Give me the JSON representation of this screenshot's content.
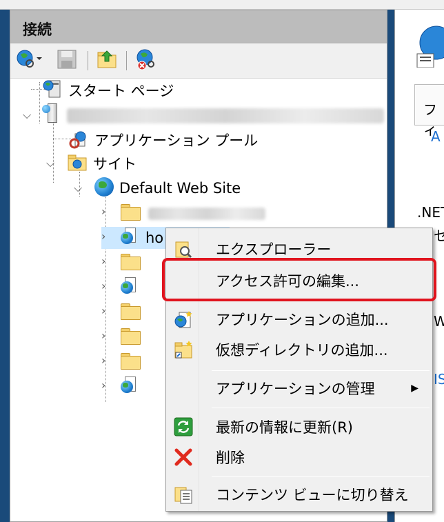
{
  "panel": {
    "title": "接続"
  },
  "toolbar": {
    "icons": [
      "connect-globe-icon",
      "save-icon",
      "up-folder-icon",
      "disconnect-icon"
    ]
  },
  "tree": {
    "start_page": "スタート ページ",
    "server": "",
    "app_pools": "アプリケーション プール",
    "sites": "サイト",
    "default_site": "Default Web Site",
    "selected_app": "ho"
  },
  "context_menu": {
    "items": [
      {
        "label": "エクスプローラー",
        "icon": "explorer-icon"
      },
      {
        "label": "アクセス許可の編集...",
        "icon": ""
      },
      {
        "label": "アプリケーションの追加...",
        "icon": "add-application-icon"
      },
      {
        "label": "仮想ディレクトリの追加...",
        "icon": "add-virtual-directory-icon"
      },
      {
        "label": "アプリケーションの管理",
        "icon": ""
      },
      {
        "label": "最新の情報に更新(R)",
        "icon": "refresh-icon"
      },
      {
        "label": "削除",
        "icon": "delete-icon"
      },
      {
        "label": "コンテンツ ビューに切り替え",
        "icon": "content-view-icon"
      }
    ]
  },
  "right_panel": {
    "tab": "フィ",
    "a1": "A",
    "net": ".NET",
    "se": "セ",
    "w": "W",
    "is": "IS"
  },
  "colors": {
    "highlight": "#e0141e",
    "header": "#bcbcbc"
  }
}
